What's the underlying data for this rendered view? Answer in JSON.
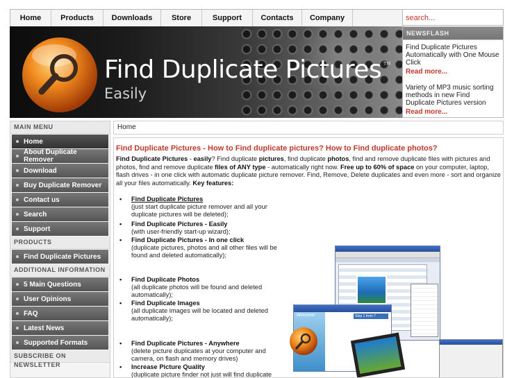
{
  "topnav": {
    "items": [
      "Home",
      "Products",
      "Downloads",
      "Store",
      "Support",
      "Contacts",
      "Company"
    ]
  },
  "search": {
    "placeholder": "search..."
  },
  "banner": {
    "title": "Find Duplicate Pictures",
    "tm": "TM",
    "subtitle": "Easily"
  },
  "newsflash": {
    "heading": "NEWSFLASH",
    "items": [
      {
        "text": "Find Duplicate Pictures Automatically with One Mouse Click",
        "link": "Read more..."
      },
      {
        "text": "Variety of MP3 music sorting methods in new Find Duplicate Pictures version",
        "link": "Read more..."
      }
    ]
  },
  "sidebar": {
    "main_menu_heading": "MAIN MENU",
    "main_menu": [
      "Home",
      "About Duplicate Remover",
      "Download",
      "Buy Duplicate Remover",
      "Contact us",
      "Search",
      "Support"
    ],
    "products_heading": "PRODUCTS",
    "products": [
      "Find Duplicate Pictures"
    ],
    "additional_heading": "ADDITIONAL INFORMATION",
    "additional": [
      "5 Main Questions",
      "User Opinions",
      "FAQ",
      "Latest News",
      "Supported Formats"
    ],
    "newsletter_heading": "SUBSCRIBE ON NEWSLETTER"
  },
  "breadcrumb": "Home",
  "main": {
    "title": "Find Duplicate Pictures - How to Find duplicate pictures? How to Find duplicate photos?",
    "intro": {
      "p1_bold": "Find Duplicate Pictures",
      "p2": " - ",
      "p3_bold": "easily",
      "p4": "? Find duplicate ",
      "p5_bold": "pictures",
      "p6": ", find duplicate ",
      "p7_bold": "photos",
      "p8": ", find and remove duplicate files with pictures and photos, find and remove duplicate ",
      "p9_bold": "files of ANY type",
      "p10": " - automatically right now. ",
      "p11_bold": "Free up to 60% of space",
      "p12": " on your computer, laptop, flash drives - in one click with automatic duplicate picture remover. Find, Remove, Delete duplicates and even more - sort and organize all your files automatically. ",
      "p13_bold": "Key features:"
    },
    "bullet": "•",
    "features": [
      {
        "title": "Find Duplicate Pictures",
        "desc": "(just start duplicate picture remover and all your duplicate pictures will be deleted);"
      },
      {
        "title": "Find Duplicate Pictures - Easily",
        "desc": "(with user-friendly start-up wizard);"
      },
      {
        "title": "Find Duplicate Pictures - In one click",
        "desc": "(duplicate pictures, photos and all other files will be found and deleted automatically);"
      },
      {
        "title": "Find Duplicate Photos",
        "desc": "(all duplicate photos will be found and deleted automatically);"
      },
      {
        "title": "Find Duplicate Images",
        "desc": "(all duplicate images will be located and deleted automatically);"
      },
      {
        "title": "Find Duplicate Pictures - Anywhere",
        "desc": "(delete picture duplicates at your computer and camera, on flash and memory drives)"
      },
      {
        "title": "Increase Picture Quality",
        "desc": "(duplicate picture finder not just will find duplicate"
      }
    ],
    "screenshot_labels": {
      "welcome": "Welcome!",
      "step": "Step 1 from 7"
    }
  },
  "colors": {
    "accent_red": "#c0392b",
    "menu_gray": "#666666"
  }
}
